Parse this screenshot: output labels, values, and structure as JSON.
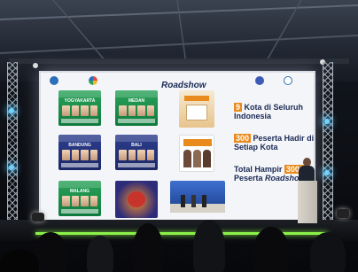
{
  "screen": {
    "title": "Roadshow",
    "logos": [
      "logo-left",
      "logo-hub",
      "logo-right-1",
      "logo-right-2"
    ],
    "cities": [
      "YOGYAKARTA",
      "MEDAN",
      "BANDUNG",
      "BALI",
      "MALANG"
    ],
    "stats": [
      {
        "number": "9",
        "text": "Kota di Seluruh Indonesia"
      },
      {
        "number": "300",
        "text": "Peserta Hadir di Setiap Kota"
      },
      {
        "prefix": "Total Hampir",
        "number": "3000",
        "text": "Peserta",
        "tail": "Roadshow"
      }
    ]
  },
  "colors": {
    "accent": "#e98a1c",
    "navy": "#1b2a55",
    "green": "#1e8f4b",
    "stage_led": "#8cf24a"
  }
}
